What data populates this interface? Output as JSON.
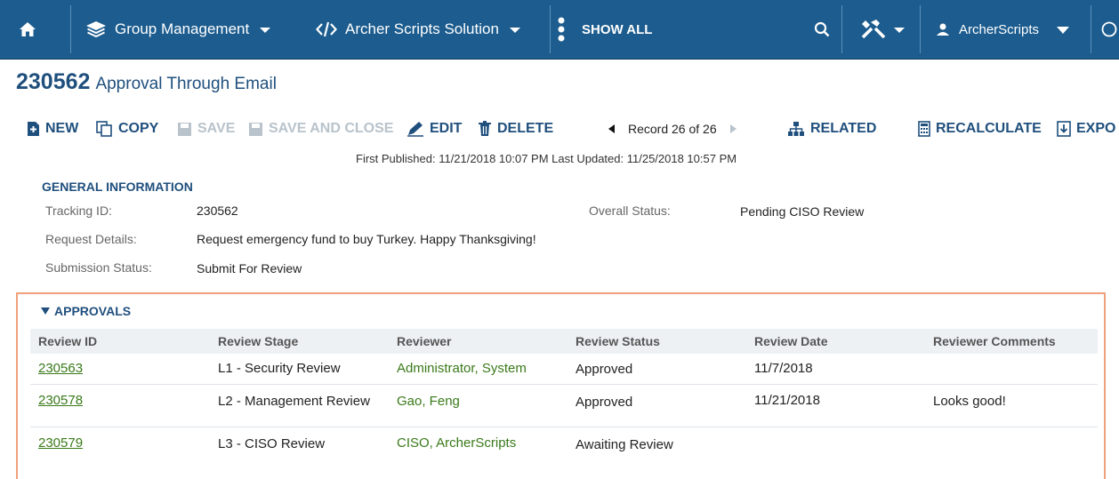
{
  "navbar": {
    "home_icon": "home-icon",
    "group_management": "Group Management",
    "archer_scripts": "Archer Scripts Solution",
    "show_all": "SHOW ALL",
    "user": "ArcherScripts",
    "background": "#1c5c8e"
  },
  "record": {
    "id": "230562",
    "name": "Approval Through Email"
  },
  "toolbar": {
    "new": "NEW",
    "copy": "COPY",
    "save": "SAVE",
    "save_close": "SAVE AND CLOSE",
    "edit": "EDIT",
    "delete": "DELETE",
    "record_nav": "Record 26 of 26",
    "related": "RELATED",
    "recalculate": "RECALCULATE",
    "export": "EXPO"
  },
  "pubinfo": "First Published: 11/21/2018 10:07 PM Last Updated: 11/25/2018 10:57 PM",
  "general": {
    "heading": "GENERAL INFORMATION",
    "tracking_label": "Tracking ID:",
    "tracking_value": "230562",
    "overall_label": "Overall Status:",
    "overall_value": "Pending CISO Review",
    "request_label": "Request Details:",
    "request_value": "Request emergency fund to buy Turkey. Happy Thanksgiving!",
    "submission_label": "Submission Status:",
    "submission_value": "Submit For Review"
  },
  "approvals": {
    "heading": "APPROVALS",
    "headers": [
      "Review ID",
      "Review Stage",
      "Reviewer",
      "Review Status",
      "Review Date",
      "Reviewer Comments"
    ],
    "rows": [
      {
        "id": "230563",
        "stage": "L1 - Security Review",
        "reviewer": "Administrator, System",
        "status": "Approved",
        "date": "11/7/2018",
        "comments": ""
      },
      {
        "id": "230578",
        "stage": "L2 - Management Review",
        "reviewer": "Gao, Feng",
        "status": "Approved",
        "date": "11/21/2018",
        "comments": "Looks good!"
      },
      {
        "id": "230579",
        "stage": "L3 - CISO Review",
        "reviewer": "CISO, ArcherScripts",
        "status": "Awaiting Review",
        "date": "",
        "comments": ""
      }
    ]
  },
  "accent": "#1f4f7d",
  "link_color": "#3a7a1a",
  "highlight_border": "#f0a07a"
}
